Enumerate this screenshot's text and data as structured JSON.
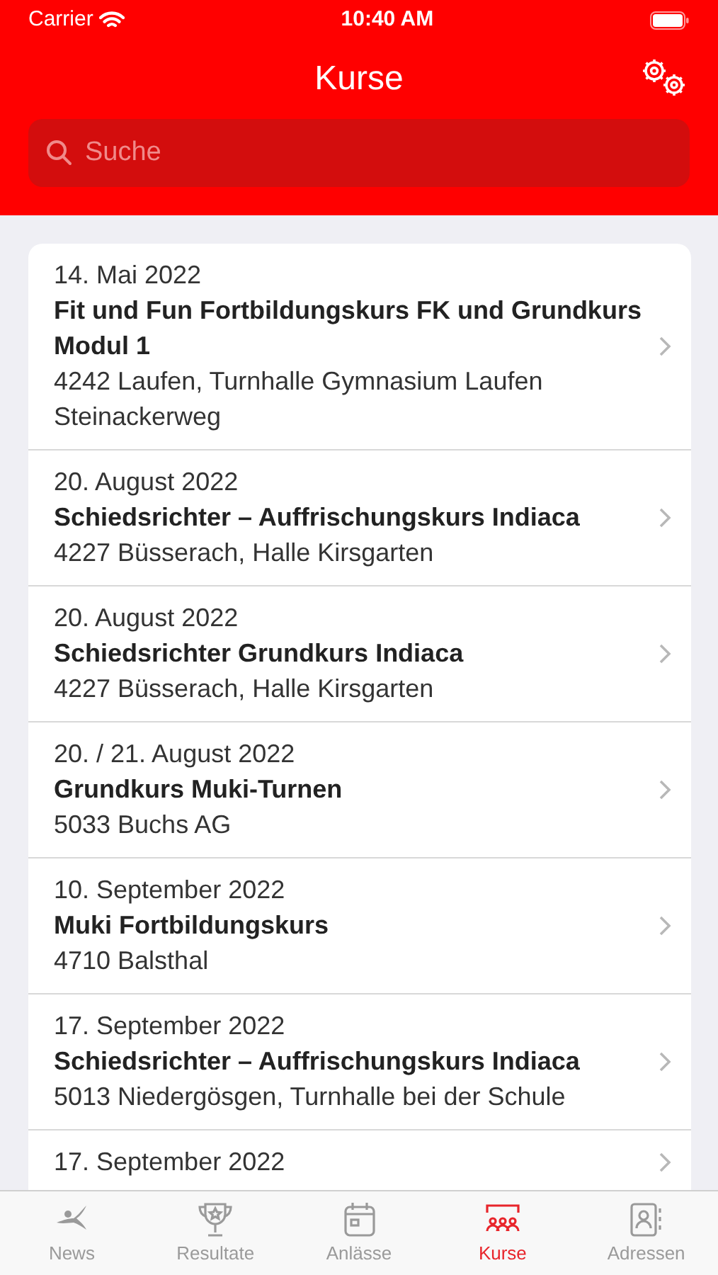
{
  "status_bar": {
    "carrier": "Carrier",
    "time": "10:40 AM"
  },
  "nav": {
    "title": "Kurse"
  },
  "search": {
    "placeholder": "Suche"
  },
  "courses": [
    {
      "date": "14. Mai 2022",
      "title": "Fit und Fun Fortbildungskurs FK und Grundkurs Modul 1",
      "location": "4242 Laufen, Turnhalle Gymnasium Laufen Steinackerweg"
    },
    {
      "date": "20. August 2022",
      "title": "Schiedsrichter – Auffrischungskurs Indiaca",
      "location": "4227 Büsserach, Halle Kirsgarten"
    },
    {
      "date": "20. August 2022",
      "title": "Schiedsrichter Grundkurs Indiaca",
      "location": "4227 Büsserach, Halle Kirsgarten"
    },
    {
      "date": "20. / 21. August 2022",
      "title": "Grundkurs Muki-Turnen",
      "location": "5033 Buchs AG"
    },
    {
      "date": "10. September 2022",
      "title": "Muki Fortbildungskurs",
      "location": "4710 Balsthal"
    },
    {
      "date": "17. September 2022",
      "title": "Schiedsrichter – Auffrischungskurs Indiaca",
      "location": "5013 Niedergösgen, Turnhalle bei der Schule"
    },
    {
      "date": "17. September 2022"
    }
  ],
  "tabs": [
    {
      "label": "News",
      "kind": "gymnast",
      "selected": false
    },
    {
      "label": "Resultate",
      "kind": "trophy",
      "selected": false
    },
    {
      "label": "Anlässe",
      "kind": "calendar",
      "selected": false
    },
    {
      "label": "Kurse",
      "kind": "group",
      "selected": true
    },
    {
      "label": "Adressen",
      "kind": "contacts",
      "selected": false
    }
  ]
}
